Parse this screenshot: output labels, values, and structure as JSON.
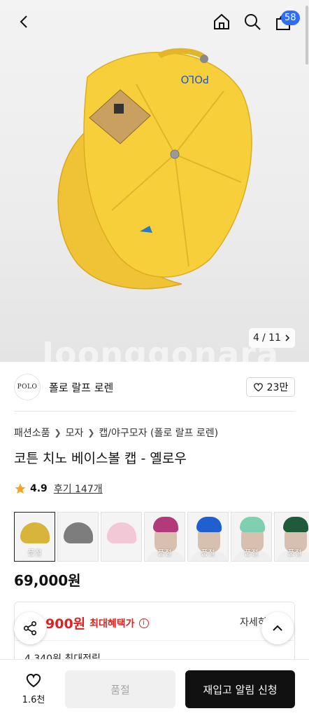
{
  "header": {
    "cart_count": "58"
  },
  "gallery": {
    "current": "4",
    "total": "/ 11",
    "watermark": "Joonggonara",
    "cap_logo": "POLO"
  },
  "brand": {
    "logo_text": "POLO",
    "name": "폴로 랄프 로렌",
    "likes": "23만"
  },
  "breadcrumb": [
    "패션소품",
    "모자",
    "캡/야구모자 (폴로 랄프 로렌)"
  ],
  "product": {
    "title": "코튼 치노 베이스볼 캡 - 옐로우",
    "rating": "4.9",
    "reviews": "후기 147개",
    "price": "69,000원"
  },
  "variants": [
    {
      "color": "#d9b43a",
      "label": "품절",
      "selected": true,
      "model": false
    },
    {
      "color": "#7d7d7d",
      "label": "",
      "selected": false,
      "model": false
    },
    {
      "color": "#f2c7d6",
      "label": "",
      "selected": false,
      "model": false
    },
    {
      "color": "#b23a7a",
      "label": "품절",
      "selected": false,
      "model": true
    },
    {
      "color": "#1f5fd0",
      "label": "품절",
      "selected": false,
      "model": true
    },
    {
      "color": "#7fcfb0",
      "label": "품절",
      "selected": false,
      "model": true
    },
    {
      "color": "#1f5a3a",
      "label": "품절",
      "selected": false,
      "model": true
    }
  ],
  "benefit": {
    "price": "900원",
    "label": "최대혜택가",
    "more": "자세히",
    "points": "4,340원 최대적립"
  },
  "bottom": {
    "wish_count": "1.6천",
    "soldout_label": "품절",
    "restock_label": "재입고 알림 신청"
  },
  "colors": {
    "accent_blue": "#2f6df6",
    "benefit_red": "#e0221f",
    "cap_yellow": "#f2c94c"
  },
  "icons": [
    "back-icon",
    "home-icon",
    "search-icon",
    "cart-icon",
    "heart-icon",
    "star-icon",
    "info-icon",
    "share-icon",
    "chevron-up-icon",
    "chevron-right-icon"
  ]
}
